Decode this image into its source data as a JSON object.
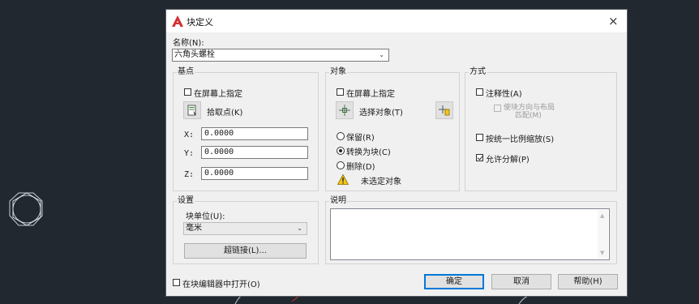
{
  "dialog": {
    "title": "块定义",
    "close": "×",
    "name_label": "名称(N):",
    "name_value": "六角头螺栓",
    "base_point": {
      "group": "基点",
      "specify_on_screen": "在屏幕上指定",
      "specify_checked": false,
      "pick_point": "拾取点(K)",
      "x_label": "X:",
      "x_value": "0.0000",
      "y_label": "Y:",
      "y_value": "0.0000",
      "z_label": "Z:",
      "z_value": "0.0000"
    },
    "objects": {
      "group": "对象",
      "specify_on_screen": "在屏幕上指定",
      "specify_checked": false,
      "select_objects": "选择对象(T)",
      "retain": "保留(R)",
      "convert": "转换为块(C)",
      "delete": "删除(D)",
      "selected_option": "convert",
      "warning": "未选定对象"
    },
    "behavior": {
      "group": "方式",
      "annotative": "注释性(A)",
      "annotative_checked": false,
      "match_orientation_line1": "使块方向与布局",
      "match_orientation_line2": "匹配(M)",
      "scale_uniformly": "按统一比例缩放(S)",
      "scale_uniformly_checked": false,
      "allow_exploding": "允许分解(P)",
      "allow_exploding_checked": true
    },
    "settings": {
      "group": "设置",
      "unit_label": "块单位(U):",
      "unit_value": "毫米",
      "hyperlink": "超链接(L)..."
    },
    "description": {
      "group": "说明",
      "value": ""
    },
    "open_in_editor": "在块编辑器中打开(O)",
    "open_in_editor_checked": false,
    "ok": "确定",
    "cancel": "取消",
    "help": "帮助(H)"
  },
  "colors": {
    "background": "#212830",
    "dialog": "#f0f0f0",
    "accent": "#0078d7",
    "logo": "#d32f2f"
  },
  "icons": [
    "autocad-logo-icon",
    "close-icon",
    "pick-point-icon",
    "select-objects-icon",
    "quick-select-icon",
    "warning-icon",
    "chevron-down-icon",
    "scroll-up-icon",
    "scroll-down-icon",
    "hexagon-drawing-icon"
  ]
}
